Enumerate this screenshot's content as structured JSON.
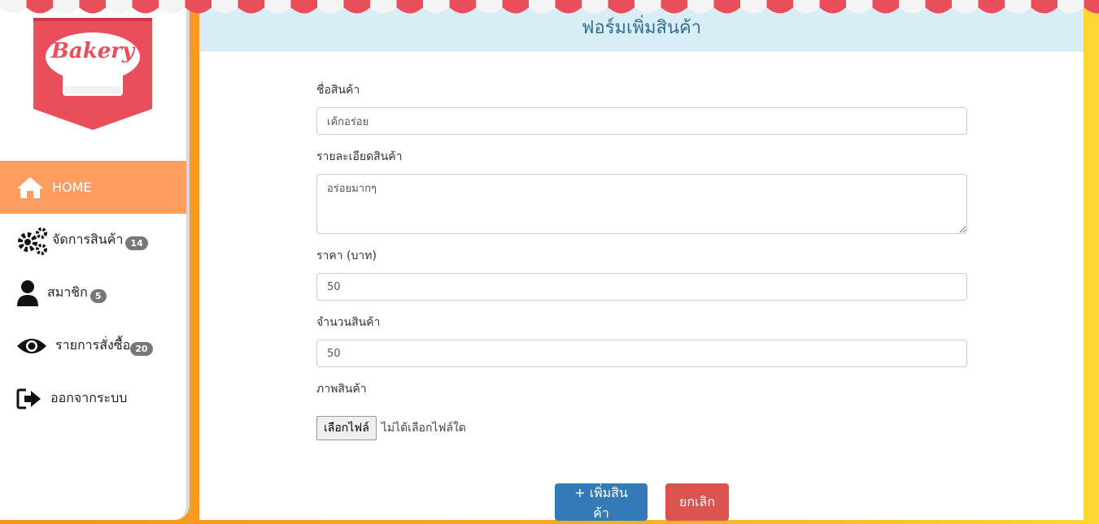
{
  "logo": {
    "text": "Bakery"
  },
  "sidebar": {
    "items": [
      {
        "label": "HOME",
        "icon": "home-icon",
        "badge": ""
      },
      {
        "label": "จัดการสินค้า",
        "icon": "gears-icon",
        "badge": "14"
      },
      {
        "label": "สมาชิก",
        "icon": "user-icon",
        "badge": "5"
      },
      {
        "label": "รายการสั่งซื้อ",
        "icon": "eye-icon",
        "badge": "20"
      },
      {
        "label": "ออกจากระบบ",
        "icon": "sign-out-icon",
        "badge": ""
      }
    ]
  },
  "main": {
    "title": "ฟอร์มเพิ่มสินค้า",
    "form": {
      "name_label": "ชื่อสินค้า",
      "name_value": "เค้กอร่อย",
      "detail_label": "รายละเอียดสินค้า",
      "detail_value": "อร่อยมากๆ",
      "price_label": "ราคา (บาท)",
      "price_value": "50",
      "qty_label": "จำนวนสินค้า",
      "qty_value": "50",
      "image_label": "ภาพสินค้า",
      "file_button": "เลือกไฟล์",
      "file_status": "ไม่ได้เลือกไฟล์ใด"
    },
    "actions": {
      "submit": "+ เพิ่มสินค้า",
      "cancel": "ยกเลิก"
    }
  },
  "colors": {
    "active_nav": "#ff9c5f",
    "header_bg": "#d9edf7",
    "header_text": "#31708f",
    "primary": "#337ab7",
    "danger": "#d9534f",
    "awning_red": "#e94f5b"
  }
}
